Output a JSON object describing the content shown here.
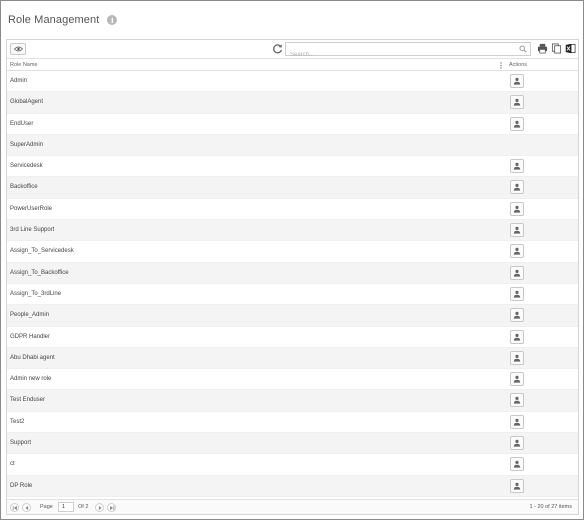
{
  "page": {
    "title": "Role Management"
  },
  "toolbar": {
    "search_placeholder": "Search..."
  },
  "grid": {
    "columns": {
      "role_name": "Role Name",
      "actions": "Actions"
    },
    "rows": [
      {
        "name": "Admin",
        "has_action": true
      },
      {
        "name": "GlobalAgent",
        "has_action": true
      },
      {
        "name": "EndUser",
        "has_action": true
      },
      {
        "name": "SuperAdmin",
        "has_action": false
      },
      {
        "name": "Servicedesk",
        "has_action": true
      },
      {
        "name": "Backoffice",
        "has_action": true
      },
      {
        "name": "PowerUserRole",
        "has_action": true
      },
      {
        "name": "3rd Line Support",
        "has_action": true
      },
      {
        "name": "Assign_To_Servicedesk",
        "has_action": true
      },
      {
        "name": "Assign_To_Backoffice",
        "has_action": true
      },
      {
        "name": "Assign_To_3rdLine",
        "has_action": true
      },
      {
        "name": "People_Admin",
        "has_action": true
      },
      {
        "name": "GDPR Handler",
        "has_action": true
      },
      {
        "name": "Abu Dhabi agent",
        "has_action": true
      },
      {
        "name": "Admin new role",
        "has_action": true
      },
      {
        "name": "Test Enduser",
        "has_action": true
      },
      {
        "name": "Test2",
        "has_action": true
      },
      {
        "name": "Support",
        "has_action": true
      },
      {
        "name": "ct",
        "has_action": true
      },
      {
        "name": "DP Role",
        "has_action": true
      }
    ]
  },
  "pager": {
    "page_label": "Page",
    "page_value": "1",
    "of_label": "Of 2",
    "info": "1 - 20 of 27 items"
  },
  "colors": {
    "border": "#8a8a8a",
    "alt_row": "#f4f4f4",
    "icon": "#666666"
  }
}
